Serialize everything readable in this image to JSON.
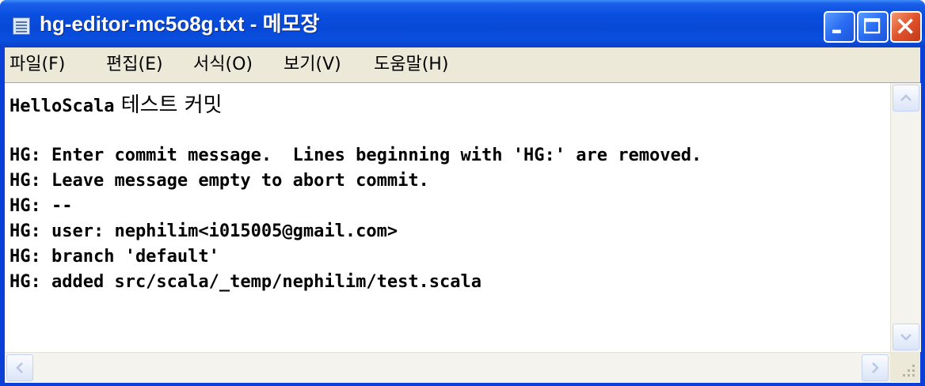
{
  "window": {
    "title": "hg-editor-mc5o8g.txt - 메모장"
  },
  "menu": {
    "items": [
      {
        "label": "파일(F)"
      },
      {
        "label": "편집(E)"
      },
      {
        "label": "서식(O)"
      },
      {
        "label": "보기(V)"
      },
      {
        "label": "도움말(H)"
      }
    ]
  },
  "editor": {
    "first_line_latin": "HelloScala",
    "first_line_korean": " 테스트 커밋",
    "lines": [
      "",
      "HG: Enter commit message.  Lines beginning with 'HG:' are removed.",
      "HG: Leave message empty to abort commit.",
      "HG: --",
      "HG: user: nephilim<i015005@gmail.com>",
      "HG: branch 'default'",
      "HG: added src/scala/_temp/nephilim/test.scala"
    ]
  },
  "icons": {
    "app": "notepad-icon",
    "minimize": "minimize-icon",
    "maximize": "maximize-icon",
    "close": "close-icon"
  },
  "colors": {
    "titlebar": "#0a4fe0",
    "close_button": "#e0522c",
    "menubar": "#ece9d8",
    "editor_bg": "#ffffff"
  }
}
